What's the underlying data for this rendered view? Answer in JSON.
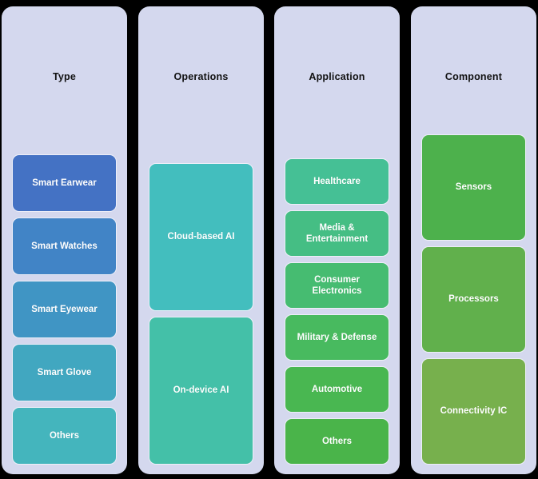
{
  "canvas": {
    "background": "#000000",
    "panel_background": "#D4D8EE",
    "chip_border": "#EDEFF8",
    "chip_text_color": "#FFFFFF",
    "title_color": "#111111"
  },
  "columns": [
    {
      "title": "Type",
      "items": [
        {
          "label": "Smart Earwear",
          "color": "#4472C4"
        },
        {
          "label": "Smart Watches",
          "color": "#4184C6"
        },
        {
          "label": "Smart Eyewear",
          "color": "#4095C4"
        },
        {
          "label": "Smart Glove",
          "color": "#41A7C0"
        },
        {
          "label": "Others",
          "color": "#44B5BD"
        }
      ]
    },
    {
      "title": "Operations",
      "items": [
        {
          "label": "Cloud-based AI",
          "color": "#43BEBE"
        },
        {
          "label": "On-device AI",
          "color": "#44C0A8"
        }
      ]
    },
    {
      "title": "Application",
      "items": [
        {
          "label": "Healthcare",
          "color": "#45C095"
        },
        {
          "label": "Media & Entertainment",
          "color": "#45BE84"
        },
        {
          "label": "Consumer Electronics",
          "color": "#46BC71"
        },
        {
          "label": "Military & Defense",
          "color": "#48BA5F"
        },
        {
          "label": "Automotive",
          "color": "#49B751"
        },
        {
          "label": "Others",
          "color": "#4AB44A"
        }
      ]
    },
    {
      "title": "Component",
      "items": [
        {
          "label": "Sensors",
          "color": "#4DB14C"
        },
        {
          "label": "Processors",
          "color": "#61B04C"
        },
        {
          "label": "Connectivity IC",
          "color": "#77B04D"
        }
      ]
    }
  ]
}
